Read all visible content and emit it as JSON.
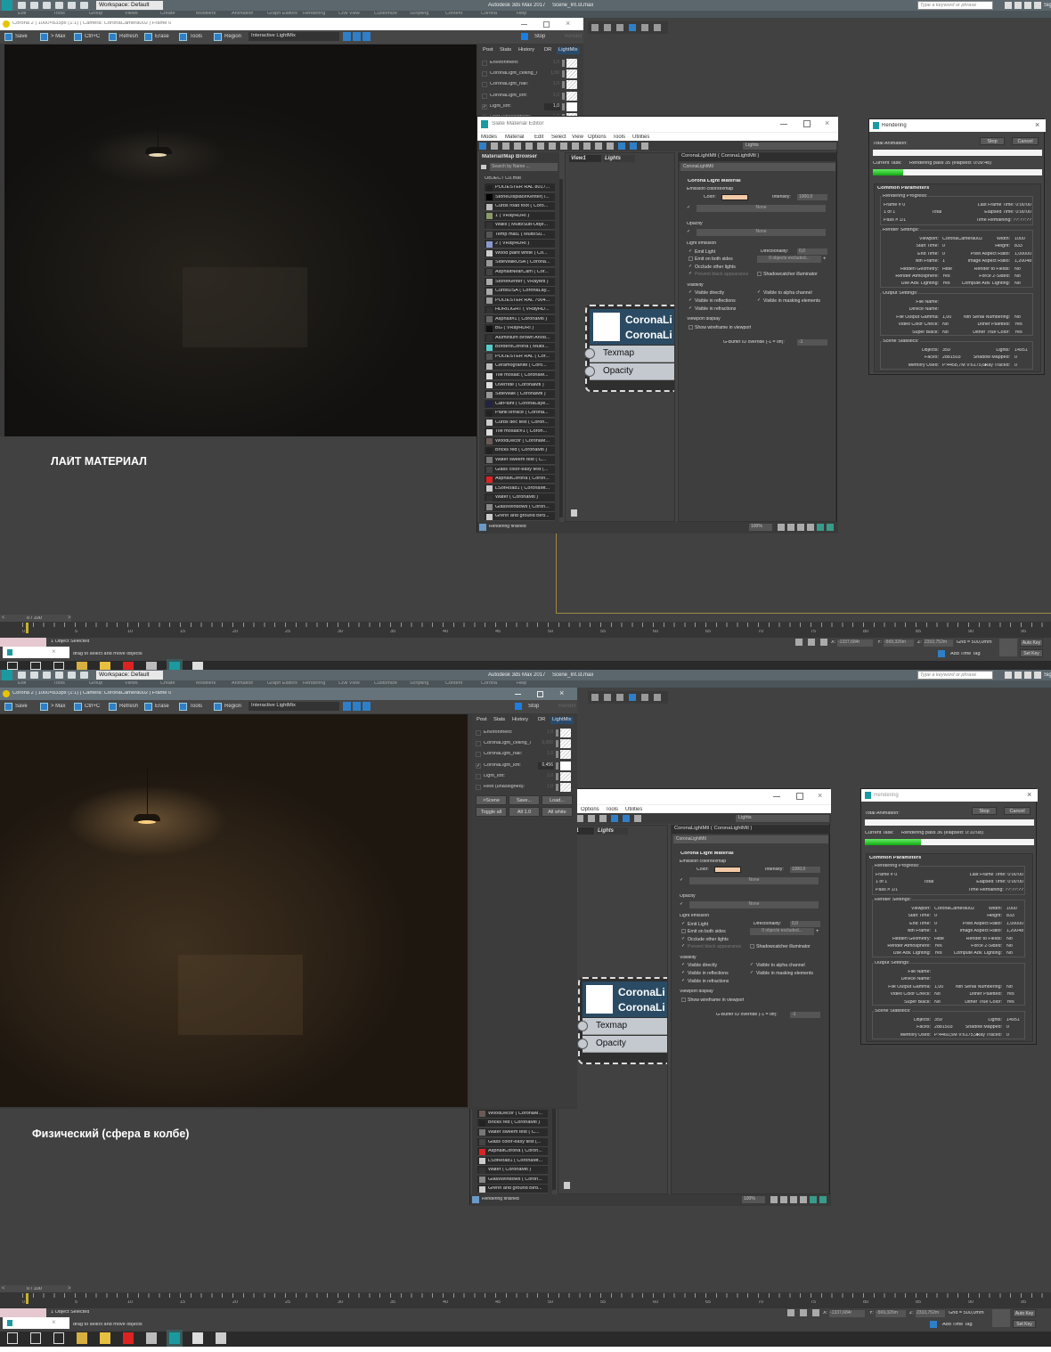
{
  "app": {
    "title": "Autodesk 3ds Max 2017",
    "file": "Scene_Int.st.max",
    "workspace": "Workspace: Default",
    "search_placeholder": "Type a keyword or phrase",
    "sign_in": "Sign In",
    "menus": [
      "Edit",
      "Tools",
      "Group",
      "Views",
      "Create",
      "Modifiers",
      "Animation",
      "Graph Editors",
      "Rendering",
      "Civil View",
      "Customize",
      "Scripting",
      "Content",
      "Corona",
      "Help"
    ]
  },
  "vfb_toolbar": {
    "save": "Save",
    "to_max": "> Max",
    "copy": "Ctrl+C",
    "refresh": "Refresh",
    "erase": "Erase",
    "tools": "Tools",
    "region": "Region",
    "mode": "Interactive LightMix",
    "stop": "Stop",
    "render": "Render"
  },
  "vfb_tabs": [
    "Post",
    "Stats",
    "History",
    "DR",
    "LightMix"
  ],
  "lightmix_buttons": [
    ">Scene",
    "Save...",
    "Load...",
    "Toggle all",
    "All 1.0",
    "All white"
  ],
  "slate": {
    "title": "Slate Material Editor",
    "menus": [
      "Modes",
      "Material",
      "Edit",
      "Select",
      "View",
      "Options",
      "Tools",
      "Utilities"
    ],
    "view_dropdown": "Lights",
    "browser_title": "Material/Map Browser",
    "search_placeholder": "Search by Name ...",
    "group": "OBJECT C0.mat",
    "items": [
      {
        "label": "POLIESTER RAL 8017...",
        "swatch": "#222"
      },
      {
        "label": "StoneDisplaceKenter(T...",
        "swatch": "#000"
      },
      {
        "label": "Curbs road foot ( Coro...",
        "swatch": "#bbb"
      },
      {
        "label": "1 ( VRayHDRI )",
        "swatch": "#8a9a6a"
      },
      {
        "label": "Walls ( Multi/Sub-Obje...",
        "swatch": "#333"
      },
      {
        "label": "Temp mat1 ( Multi/Su...",
        "swatch": "#555"
      },
      {
        "label": "2 ( VRayHDRI )",
        "swatch": "#8a9ad0"
      },
      {
        "label": "Wood paint white ( Co...",
        "swatch": "#ccc"
      },
      {
        "label": "SideWalkUSA ( Corona...",
        "swatch": "#999"
      },
      {
        "label": "AsphaltNearCam ( Cor...",
        "swatch": "#444"
      },
      {
        "label": "StoneKenter ( VRayMtl )",
        "swatch": "#aaa"
      },
      {
        "label": "CurbsUSA ( CoronaLay...",
        "swatch": "#aaa"
      },
      {
        "label": "POLIESTER RAL 7004...",
        "swatch": "#999"
      },
      {
        "label": "HDRILIGHT ( VRayHD...",
        "swatch": "#333"
      },
      {
        "label": "Asphalt#1 ( CoronaMtl )",
        "swatch": "#666"
      },
      {
        "label": "BG ( VRayHDRI )",
        "swatch": "#111"
      },
      {
        "label": "Aluminium Brown Anod...",
        "swatch": "#333"
      },
      {
        "label": "BordersCorona ( Multi/...",
        "swatch": "#5cc"
      },
      {
        "label": "POLIESTER RAL ( Cor...",
        "swatch": "#555"
      },
      {
        "label": "Ceramogranite ( Coro...",
        "swatch": "#bbb"
      },
      {
        "label": "Tile mosaic ( CoronaM...",
        "swatch": "#ddd"
      },
      {
        "label": "Override ( CoronaMtl )",
        "swatch": "#ddd"
      },
      {
        "label": "SideWalk ( CoronaMtl )",
        "swatch": "#999"
      },
      {
        "label": "CarPaint ( CoronaLaye...",
        "swatch": "#224"
      },
      {
        "label": "PlankTerrace ( Corona...",
        "swatch": "#222"
      },
      {
        "label": "Curbs dec test ( Coron...",
        "swatch": "#ccc"
      },
      {
        "label": "Tile mosaic#1 ( Coron...",
        "swatch": "#ddd"
      },
      {
        "label": "WoodDecor ( CoronaM...",
        "swatch": "#6a5a55"
      },
      {
        "label": "Bricks red ( CoronaMtl )",
        "swatch": "#222"
      },
      {
        "label": "Water sweem test ( C...",
        "swatch": "#777"
      },
      {
        "label": "Glass color-easy test (...",
        "swatch": "#444"
      },
      {
        "label": "AsphaltCorona ( Coron...",
        "swatch": "#d22"
      },
      {
        "label": "LSofRoad1 ( CoronaMt...",
        "swatch": "#ccc"
      },
      {
        "label": "Water ( CoronaMtl )",
        "swatch": "#333"
      },
      {
        "label": "GlassWindows ( Coron...",
        "swatch": "#888"
      },
      {
        "label": "Grenn and ground Bird...",
        "swatch": "#ccc"
      }
    ],
    "view_tabs": [
      "View1",
      "Lights"
    ],
    "node": {
      "title1": "CoronaLi",
      "title2": "CoronaLi",
      "slots": [
        "Texmap",
        "Opacity"
      ]
    },
    "status": "Rendering finished",
    "zoom": "100%",
    "params": {
      "header": "CoronaLightMtl  ( CoronaLightMtl )",
      "name": "CoronaLightMtl",
      "rollout": "Corona Light Material",
      "emission_label": "Emission color/texmap",
      "color_label": "Color:",
      "color": "#f2c9a6",
      "intensity_label": "Intensity:",
      "intensity": "1000,0",
      "none": "None",
      "opacity_label": "Opacity",
      "light_emission_label": "Light emission",
      "emit_light": "Emit Light",
      "directionality_label": "Directionality:",
      "directionality": "0,0",
      "emit_both": "Emit on both sides",
      "excluded": "0 objects excluded...",
      "occlude": "Occlude other lights",
      "prevent_black": "Prevent black appearance",
      "shadowcatcher": "Shadowcatcher illuminator",
      "visibility_label": "Visibility",
      "vis_directly": "Visible directly",
      "vis_alpha": "Visible to alpha channel",
      "vis_reflections": "Visible in reflections",
      "vis_masking": "Visible in masking elements",
      "vis_refractions": "Visible in refractions",
      "viewport_label": "Viewport display",
      "show_wireframe": "Show wireframe in viewport",
      "gbuffer_label": "G-Buffer ID override (-1 = off):",
      "gbuffer": "-1"
    }
  },
  "rendering_common": {
    "title": "Rendering",
    "total_animation": "Total Animation:",
    "stop": "Stop",
    "cancel": "Cancel",
    "current_task": "Current Task:",
    "rollout": "Common Parameters",
    "progress_label": "Rendering Progress:",
    "progress_rows": [
      [
        "Frame #  0",
        "",
        "Last Frame Time:  0:00:00"
      ],
      [
        "1 of 1",
        "Total",
        "Elapsed Time:  0:00:00"
      ],
      [
        "Pass #  1/1",
        "",
        "Time Remaining:  ??:??:??"
      ]
    ],
    "settings_label": "Render Settings:",
    "settings_rows": [
      [
        "Viewport:",
        "CoronaCamera002",
        "Width:",
        "1000"
      ],
      [
        "Start Time:",
        "0",
        "Height:",
        "833"
      ],
      [
        "End Time:",
        "0",
        "Pixel Aspect Ratio:",
        "1,00000"
      ],
      [
        "Nth Frame:",
        "1",
        "Image Aspect Ratio:",
        "1,20048"
      ],
      [
        "Hidden Geometry:",
        "Hide",
        "Render to Fields:",
        "No"
      ],
      [
        "Render Atmosphere:",
        "Yes",
        "Force 2-Sided:",
        "No"
      ],
      [
        "Use Adv. Lighting:",
        "Yes",
        "Compute Adv. Lighting:",
        "No"
      ]
    ],
    "output_label": "Output Settings:",
    "output_rows": [
      [
        "File Name:",
        "",
        "",
        ""
      ],
      [
        "Device Name:",
        "",
        "",
        ""
      ],
      [
        "File Output Gamma:",
        "1,00",
        "Nth Serial Numbering:",
        "No"
      ],
      [
        "Video Color Check:",
        "No",
        "Dither Paletted:",
        "Yes"
      ],
      [
        "Super Black:",
        "No",
        "Dither True Color:",
        "Yes"
      ]
    ],
    "stats_label": "Scene Statistics:"
  },
  "timeline": {
    "frame": "0 / 100",
    "ticks": [
      "0",
      "5",
      "10",
      "15",
      "20",
      "25",
      "30",
      "35",
      "40",
      "45",
      "50",
      "55",
      "60",
      "65",
      "70",
      "75",
      "80",
      "85",
      "90",
      "95"
    ]
  },
  "status": {
    "selected": "1 Object Selected",
    "prompt": "drag to select and move objects",
    "x_label": "X:",
    "x": "-1337,684r",
    "y_label": "Y:",
    "y": "-569,326m",
    "z_label": "Z:",
    "z": "2310,752m",
    "grid": "Grid = 500,0mm",
    "add_time_tag": "Add Time Tag",
    "auto_key": "Auto Key",
    "set_key": "Set Key"
  },
  "panels": [
    {
      "caption": "ЛАЙТ МАТЕРИАЛ",
      "vfb_title": "Corona 2 | 1000×833px (1:1) | Camera: CoronaCamera002 | Frame 0",
      "lightmix": [
        {
          "name": "Environment:",
          "value": "1,0",
          "checked": false
        },
        {
          "name": "CoronaLight_celling_l",
          "value": "1,00",
          "checked": false
        },
        {
          "name": "CoronaLight_hall:",
          "value": "1,0",
          "checked": false
        },
        {
          "name": "CoronaLight_loft:",
          "value": "1,0",
          "checked": false
        },
        {
          "name": "Light_loft:",
          "value": "1,0",
          "checked": true
        },
        {
          "name": "Rest (unassigned):",
          "value": "1,0",
          "checked": false
        }
      ],
      "render_task": "Rendering pass 35 (elapsed: 0:09:48)",
      "task_progress": 0.18,
      "stats_rows": [
        [
          "Objects:",
          "359",
          "Lights:",
          "14951"
        ],
        [
          "Faces:",
          "2881503",
          "Shadow Mapped:",
          "0"
        ],
        [
          "Memory Used:",
          "P:4458,7M V:6175,6I",
          "Ray Traced:",
          "0"
        ]
      ],
      "taskbar": [
        "windows-start",
        "search",
        "task-view",
        "app-a",
        "file-explorer",
        "opera",
        "calculator",
        "3ds-max",
        "photos"
      ]
    },
    {
      "caption": "Физический (сфера в колбе)",
      "vfb_title": "Corona 2 | 1000×833px (1:1) | Camera: CoronaCamera002 | Frame 0",
      "lightmix": [
        {
          "name": "Environment:",
          "value": "1,0",
          "checked": false
        },
        {
          "name": "CoronaLight_celling_l",
          "value": "0,000",
          "checked": false
        },
        {
          "name": "CoronaLight_hall:",
          "value": "1,0",
          "checked": false
        },
        {
          "name": "CoronaLight_loft:",
          "value": "0,456",
          "checked": true
        },
        {
          "name": "Light_loft:",
          "value": "1,0",
          "checked": false
        },
        {
          "name": "Rest (unassigned):",
          "value": "1,0",
          "checked": false
        }
      ],
      "render_task": "Rendering pass 36 (elapsed: 0:10:08)",
      "task_progress": 0.33,
      "stats_rows": [
        [
          "Objects:",
          "359",
          "Lights:",
          "14951"
        ],
        [
          "Faces:",
          "2881503",
          "Shadow Mapped:",
          "0"
        ],
        [
          "Memory Used:",
          "P:4460,5M V:6175,9I",
          "Ray Traced:",
          "0"
        ]
      ],
      "taskbar": [
        "windows-start",
        "search",
        "task-view",
        "app-a",
        "file-explorer",
        "opera",
        "calculator",
        "3ds-max",
        "photos",
        "media-player"
      ]
    }
  ]
}
